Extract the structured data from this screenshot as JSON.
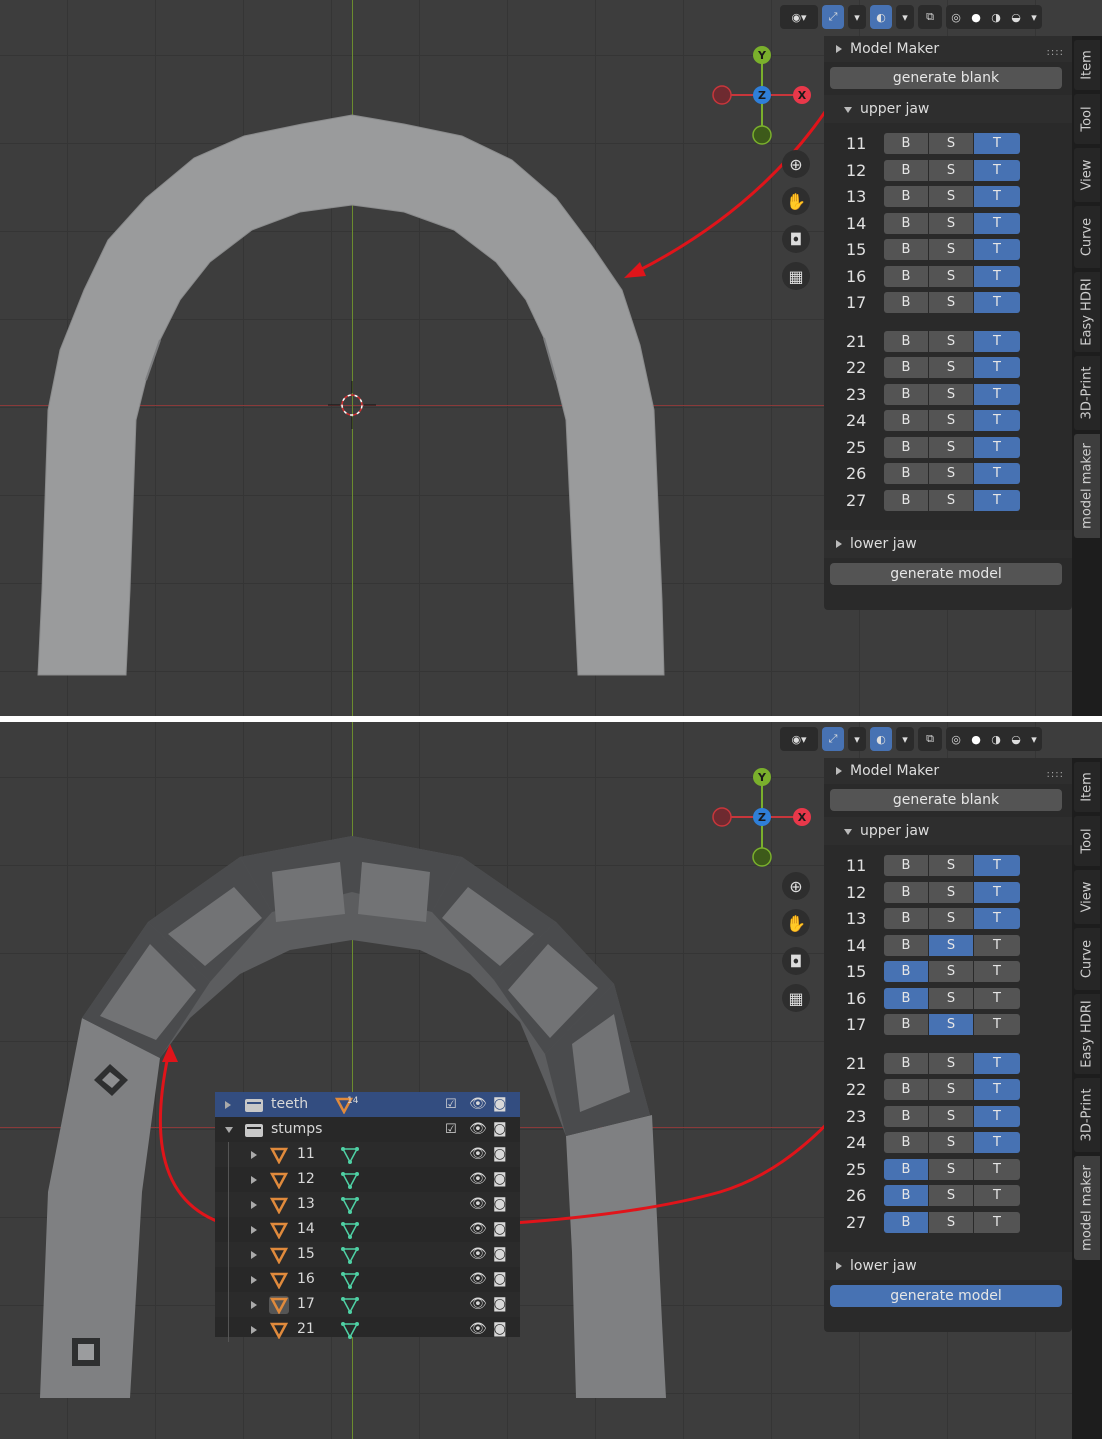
{
  "panel": {
    "title": "Model Maker",
    "generate_blank": "generate blank",
    "upper_jaw": "upper jaw",
    "lower_jaw": "lower jaw",
    "generate_model": "generate model",
    "btn_b": "B",
    "btn_s": "S",
    "btn_t": "T"
  },
  "tabs": [
    "Item",
    "Tool",
    "View",
    "Curve",
    "Easy HDRI",
    "3D-Print",
    "model maker"
  ],
  "gizmo": {
    "x": "X",
    "y": "Y",
    "z": "Z"
  },
  "colors": {
    "accent": "#4772b3",
    "arrow": "#e0141a",
    "mesh": "#9a9b9c",
    "orange": "#e08a3c",
    "green": "#4fd1a5"
  },
  "top_view": {
    "teeth": [
      {
        "num": "11",
        "sel": "T"
      },
      {
        "num": "12",
        "sel": "T"
      },
      {
        "num": "13",
        "sel": "T"
      },
      {
        "num": "14",
        "sel": "T"
      },
      {
        "num": "15",
        "sel": "T"
      },
      {
        "num": "16",
        "sel": "T"
      },
      {
        "num": "17",
        "sel": "T"
      },
      {
        "num": "21",
        "sel": "T"
      },
      {
        "num": "22",
        "sel": "T"
      },
      {
        "num": "23",
        "sel": "T"
      },
      {
        "num": "24",
        "sel": "T"
      },
      {
        "num": "25",
        "sel": "T"
      },
      {
        "num": "26",
        "sel": "T"
      },
      {
        "num": "27",
        "sel": "T"
      }
    ],
    "generate_model_active": false
  },
  "bottom_view": {
    "teeth": [
      {
        "num": "11",
        "sel": "T"
      },
      {
        "num": "12",
        "sel": "T"
      },
      {
        "num": "13",
        "sel": "T"
      },
      {
        "num": "14",
        "sel": "S"
      },
      {
        "num": "15",
        "sel": "B"
      },
      {
        "num": "16",
        "sel": "B"
      },
      {
        "num": "17",
        "sel": "S"
      },
      {
        "num": "21",
        "sel": "T"
      },
      {
        "num": "22",
        "sel": "T"
      },
      {
        "num": "23",
        "sel": "T"
      },
      {
        "num": "24",
        "sel": "T"
      },
      {
        "num": "25",
        "sel": "B"
      },
      {
        "num": "26",
        "sel": "B"
      },
      {
        "num": "27",
        "sel": "B"
      }
    ],
    "generate_model_active": true
  },
  "outliner": {
    "teeth_label": "teeth",
    "teeth_badge": "14",
    "stumps_label": "stumps",
    "children": [
      "11",
      "12",
      "13",
      "14",
      "15",
      "16",
      "17",
      "21"
    ]
  }
}
